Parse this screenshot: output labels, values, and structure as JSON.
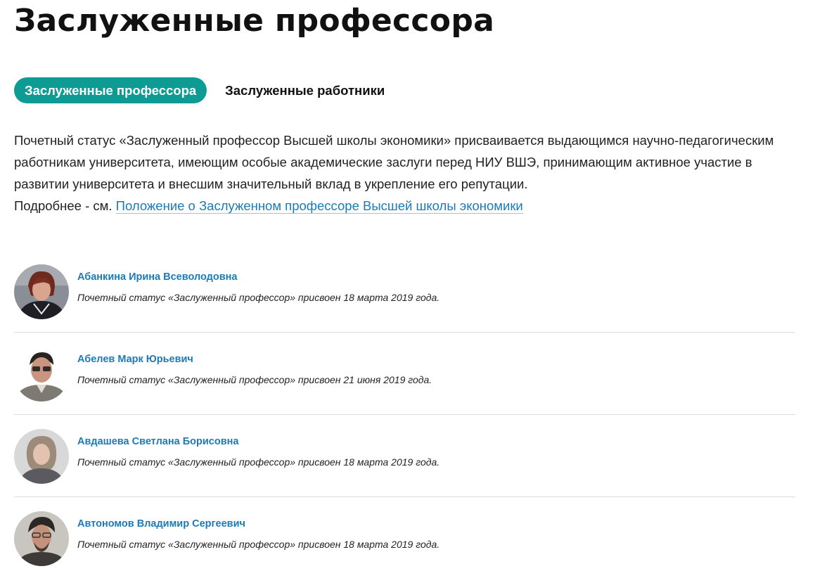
{
  "page": {
    "title": "Заслуженные профессора"
  },
  "tabs": [
    {
      "label": "Заслуженные профессора",
      "active": true
    },
    {
      "label": "Заслуженные работники",
      "active": false
    }
  ],
  "intro": {
    "text": "Почетный статус «Заслуженный профессор Высшей школы экономики» присваивается выдающимся научно-педагогическим работникам университета, имеющим особые академические заслуги перед НИУ ВШЭ, принимающим активное участие в развитии университета и внесшим значительный вклад в укрепление его репутации.",
    "more_prefix": "Подробнее - см. ",
    "more_link": "Положение о Заслуженном профессоре Высшей школы экономики"
  },
  "people": [
    {
      "name": "Абанкина Ирина Всеволодовна",
      "status": "Почетный статус «Заслуженный профессор» присвоен 18 марта 2019 года."
    },
    {
      "name": "Абелев Марк Юрьевич",
      "status": "Почетный статус «Заслуженный профессор» присвоен 21 июня 2019 года."
    },
    {
      "name": "Авдашева Светлана Борисовна",
      "status": "Почетный статус «Заслуженный профессор» присвоен 18 марта 2019 года."
    },
    {
      "name": "Автономов Владимир Сергеевич",
      "status": "Почетный статус «Заслуженный профессор» присвоен 18 марта 2019 года."
    }
  ],
  "colors": {
    "accent": "#0e9b93",
    "link": "#1a7bb8"
  }
}
